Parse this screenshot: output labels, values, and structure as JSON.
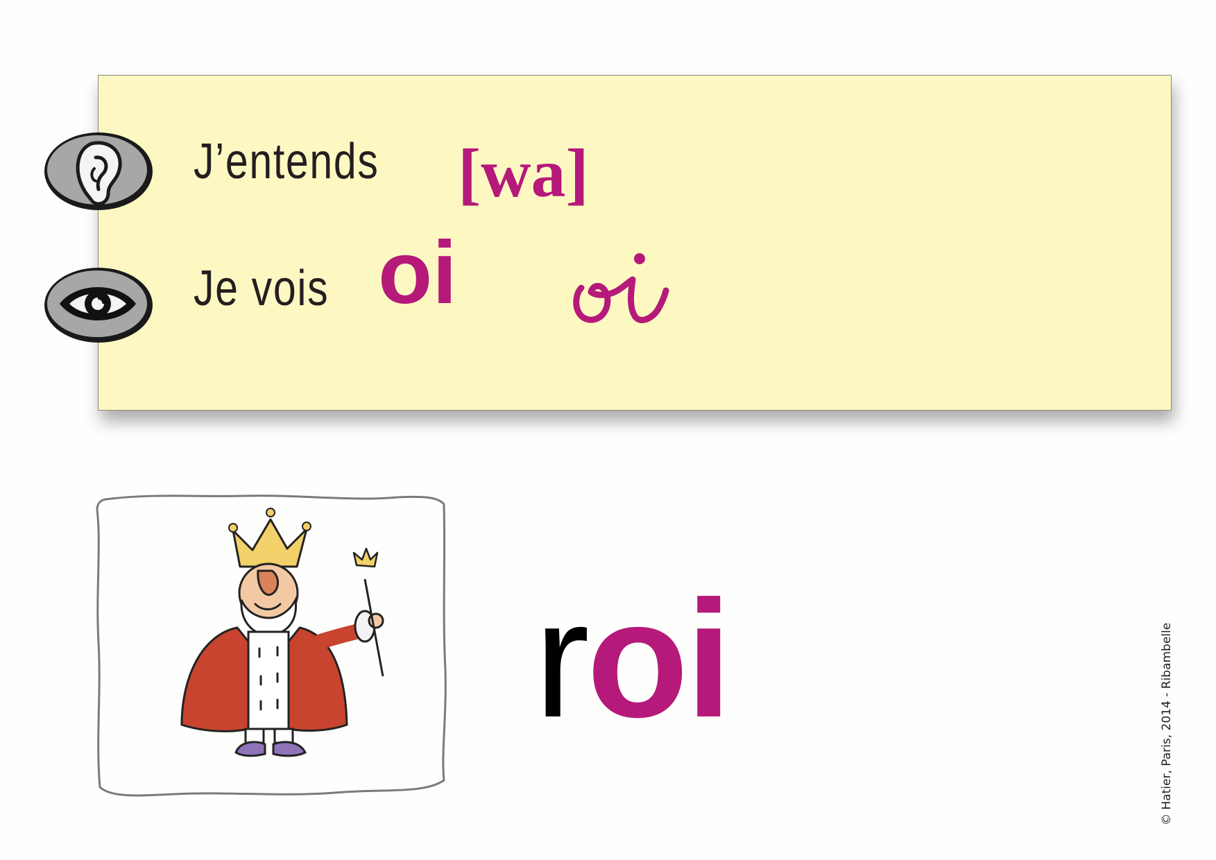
{
  "card": {
    "hear_label": "J’entends",
    "phoneme": "[wa]",
    "see_label": "Je vois",
    "grapheme_print": "oi",
    "grapheme_cursive": "oi",
    "icons": {
      "hear": "ear-icon",
      "see": "eye-icon"
    }
  },
  "example": {
    "word_plain": "r",
    "word_highlight": "oi",
    "image": "king-illustration"
  },
  "copyright": "© Hatier, Paris, 2014 - Ribambelle",
  "colors": {
    "accent": "#b5197a",
    "note_background": "#fdf8c2",
    "text": "#231f20"
  }
}
